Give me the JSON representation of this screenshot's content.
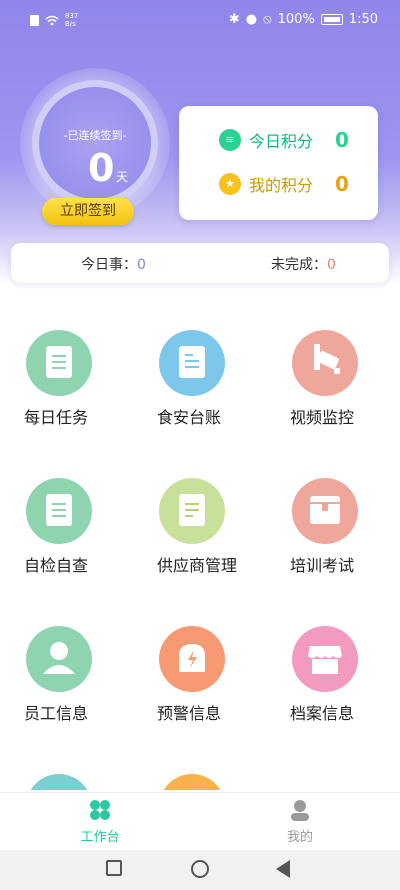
{
  "status_bar": {
    "net_speed_value": "837",
    "net_speed_unit": "B/s",
    "battery": "100%",
    "time": "1:50"
  },
  "signin": {
    "label": "-已连续签到-",
    "count": "0",
    "unit": "天",
    "button": "立即签到"
  },
  "points": {
    "today_label": "今日积分",
    "today_value": "0",
    "mine_label": "我的积分",
    "mine_value": "0"
  },
  "summary": {
    "today_label": "今日事：",
    "today_value": "0",
    "pending_label": "未完成：",
    "pending_value": "0"
  },
  "grid": [
    {
      "label": "每日任务",
      "icon": "clipboard-icon",
      "color": "#8fd4b0"
    },
    {
      "label": "食安台账",
      "icon": "ledger-icon",
      "color": "#7cc7ea"
    },
    {
      "label": "视频监控",
      "icon": "camera-icon",
      "color": "#f0a79b"
    },
    {
      "label": "自检自查",
      "icon": "clipboard-icon",
      "color": "#8fd4b0"
    },
    {
      "label": "供应商管理",
      "icon": "document-search-icon",
      "color": "#c8e09a"
    },
    {
      "label": "培训考试",
      "icon": "box-icon",
      "color": "#f0a79b"
    },
    {
      "label": "员工信息",
      "icon": "person-icon",
      "color": "#8fd4b0"
    },
    {
      "label": "预警信息",
      "icon": "alarm-icon",
      "color": "#f59a72"
    },
    {
      "label": "档案信息",
      "icon": "store-icon",
      "color": "#f29ac0"
    },
    {
      "label": "",
      "icon": "partial-icon",
      "color": "#7ccfcf"
    },
    {
      "label": "",
      "icon": "partial-icon",
      "color": "#f8b24d"
    }
  ],
  "tabbar": {
    "workbench": "工作台",
    "mine": "我的",
    "active_color": "#2bc8a2"
  }
}
